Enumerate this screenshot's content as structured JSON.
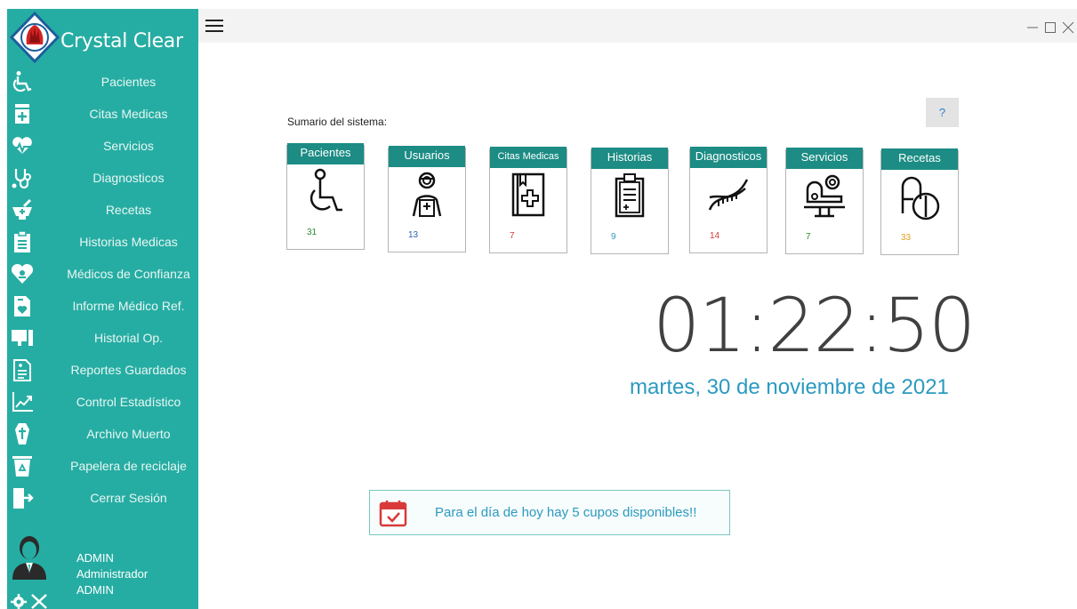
{
  "app": {
    "title": "Crystal Clear"
  },
  "colors": {
    "sidebar": "#26ada3",
    "card_header": "#1c8c84",
    "accent_text": "#2c9ac0"
  },
  "sidebar": {
    "items": [
      {
        "label": "Pacientes",
        "icon": "wheelchair-icon"
      },
      {
        "label": "Citas Medicas",
        "icon": "calendar-plus-icon"
      },
      {
        "label": "Servicios",
        "icon": "heart-hand-icon"
      },
      {
        "label": "Diagnosticos",
        "icon": "stethoscope-icon"
      },
      {
        "label": "Recetas",
        "icon": "mortar-pestle-icon"
      },
      {
        "label": "Historias Medicas",
        "icon": "clipboard-icon"
      },
      {
        "label": "Médicos de Confianza",
        "icon": "heart-pin-icon"
      },
      {
        "label": "Informe Médico Ref.",
        "icon": "medical-report-icon"
      },
      {
        "label": "Historial Op.",
        "icon": "monitor-icon"
      },
      {
        "label": "Reportes Guardados",
        "icon": "saved-report-icon"
      },
      {
        "label": "Control Estadístico",
        "icon": "chart-line-icon"
      },
      {
        "label": "Archivo Muerto",
        "icon": "coffin-icon"
      },
      {
        "label": "Papelera de reciclaje",
        "icon": "recycle-bin-icon"
      },
      {
        "label": "Cerrar Sesión",
        "icon": "logout-icon"
      }
    ],
    "user": {
      "name": "ADMIN",
      "role": "Administrador",
      "username": "ADMIN"
    }
  },
  "main": {
    "summary_title": "Sumario del sistema:",
    "help_label": "?",
    "cards": [
      {
        "label": "Pacientes",
        "count": "31",
        "count_color": "#2e8b2e",
        "icon": "wheelchair-icon"
      },
      {
        "label": "Usuarios",
        "count": "13",
        "count_color": "#2f5fb3",
        "icon": "nurse-icon"
      },
      {
        "label": "Citas Medicas",
        "count": "7",
        "count_color": "#d33a3a",
        "icon": "medical-book-icon"
      },
      {
        "label": "Historias",
        "count": "9",
        "count_color": "#2c9ac0",
        "icon": "clipboard-icon"
      },
      {
        "label": "Diagnosticos",
        "count": "14",
        "count_color": "#d33a3a",
        "icon": "dna-icon"
      },
      {
        "label": "Servicios",
        "count": "7",
        "count_color": "#2e8b2e",
        "icon": "surgery-icon"
      },
      {
        "label": "Recetas",
        "count": "33",
        "count_color": "#e0a020",
        "icon": "pill-icon"
      }
    ],
    "clock": "01:22:50",
    "date": "martes, 30 de noviembre de 2021",
    "notice": "Para el día de hoy hay 5 cupos disponibles!!"
  }
}
